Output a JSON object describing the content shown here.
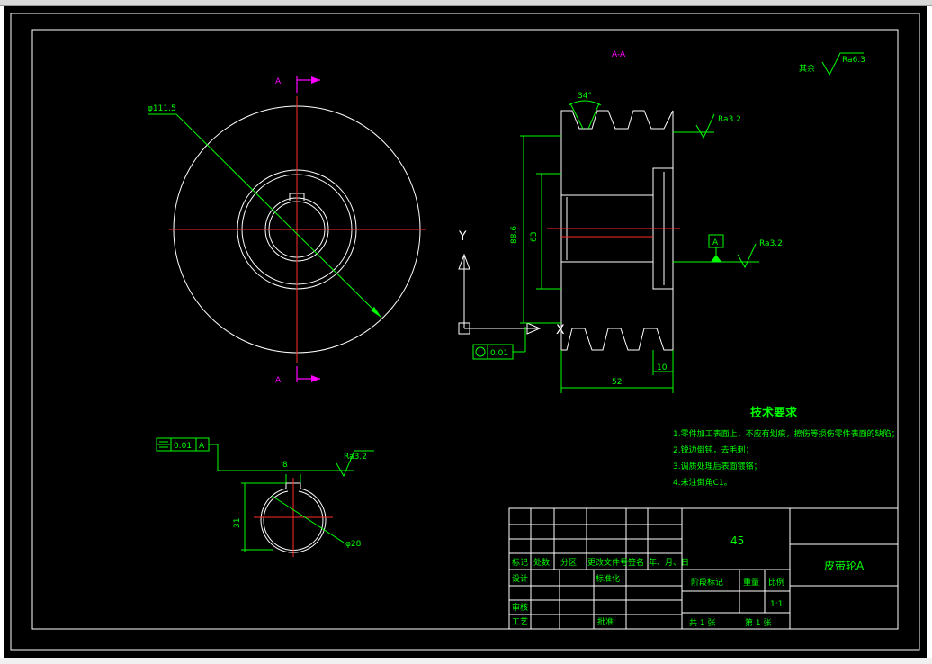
{
  "colors": {
    "background": "#000000",
    "outline": "#ffffff",
    "dimension": "#00ff00",
    "centerline": "#ff2a2a",
    "section_mark": "#ff00ff"
  },
  "section": {
    "label": "A-A",
    "mark_top": "A",
    "mark_bottom": "A"
  },
  "roughness": {
    "rest_label": "其余",
    "rest_value": "Ra6.3",
    "groove_value": "Ra3.2",
    "bore_value": "Ra3.2",
    "keyway_value": "Ra3.2"
  },
  "dims": {
    "outer_dia": "φ111.5",
    "groove_angle": "34°",
    "pitch_dia": "88.6",
    "hub_dia": "63",
    "width": "52",
    "offset": "10",
    "key_width": "8",
    "key_depth": "31",
    "bore_dia": "φ28"
  },
  "gdt": {
    "datum": "A",
    "circularity": "0.01",
    "symmetry": "0.01",
    "symmetry_datum": "A"
  },
  "axes": {
    "y": "Y",
    "x": "X"
  },
  "tech": {
    "title": "技术要求",
    "items": [
      "1.零件加工表面上，不应有划痕，擦伤等损伤零件表面的缺陷；",
      "2.锐边倒钝，去毛刺；",
      "3.调质处理后表面镀铬；",
      "4.未注倒角C1。"
    ]
  },
  "title_block": {
    "material": "45",
    "part_name": "皮带轮A",
    "headers": [
      "标记",
      "处数",
      "分区",
      "更改文件号",
      "签名",
      "年、月、日"
    ],
    "design": "设计",
    "standard": "标准化",
    "review": "审核",
    "process": "工艺",
    "approve": "批准",
    "stage_mark": "阶段标记",
    "weight": "重量",
    "scale_label": "比例",
    "scale": "1:1",
    "sheets": "共 1 张",
    "sheet_no": "第 1 张"
  }
}
